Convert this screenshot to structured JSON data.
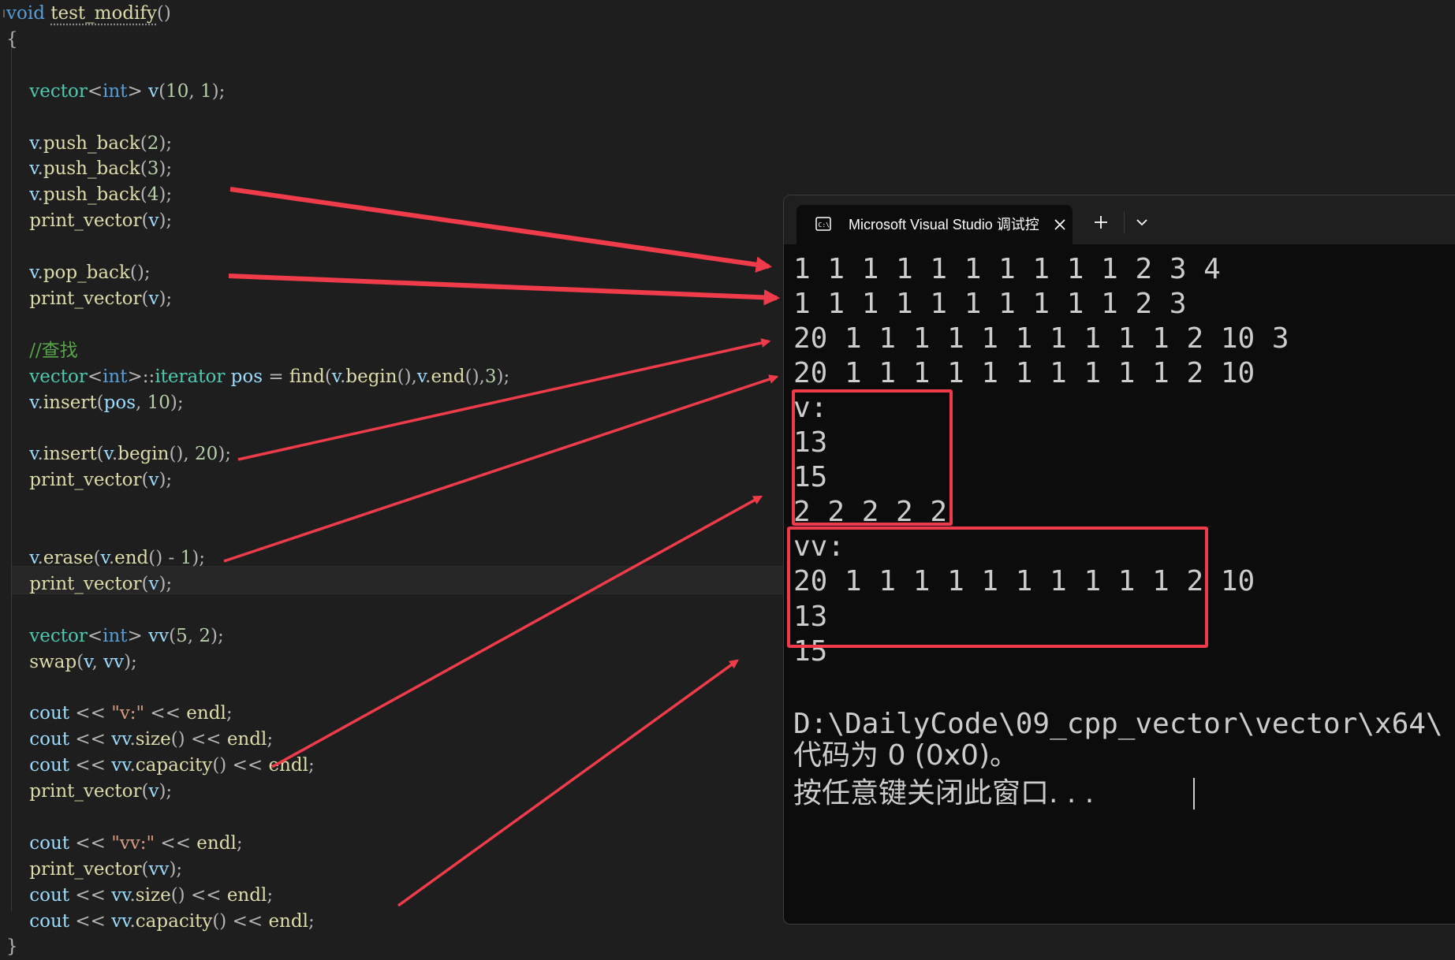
{
  "editor": {
    "lines": [
      [
        [
          "kw",
          "void"
        ],
        [
          "pl",
          " "
        ],
        [
          "fn",
          "test_modify",
          "underline"
        ],
        [
          "op",
          "()"
        ]
      ],
      [
        [
          "op",
          "{"
        ]
      ],
      [],
      [
        [
          "pl",
          "    "
        ],
        [
          "ty",
          "vector"
        ],
        [
          "op",
          "<"
        ],
        [
          "kw",
          "int"
        ],
        [
          "op",
          "> "
        ],
        [
          "va",
          "v"
        ],
        [
          "op",
          "("
        ],
        [
          "nu",
          "10"
        ],
        [
          "op",
          ", "
        ],
        [
          "nu",
          "1"
        ],
        [
          "op",
          ");"
        ]
      ],
      [],
      [
        [
          "pl",
          "    "
        ],
        [
          "va",
          "v"
        ],
        [
          "op",
          "."
        ],
        [
          "fn",
          "push_back"
        ],
        [
          "op",
          "("
        ],
        [
          "nu",
          "2"
        ],
        [
          "op",
          ");"
        ]
      ],
      [
        [
          "pl",
          "    "
        ],
        [
          "va",
          "v"
        ],
        [
          "op",
          "."
        ],
        [
          "fn",
          "push_back"
        ],
        [
          "op",
          "("
        ],
        [
          "nu",
          "3"
        ],
        [
          "op",
          ");"
        ]
      ],
      [
        [
          "pl",
          "    "
        ],
        [
          "va",
          "v"
        ],
        [
          "op",
          "."
        ],
        [
          "fn",
          "push_back"
        ],
        [
          "op",
          "("
        ],
        [
          "nu",
          "4"
        ],
        [
          "op",
          ");"
        ]
      ],
      [
        [
          "pl",
          "    "
        ],
        [
          "fn",
          "print_vector"
        ],
        [
          "op",
          "("
        ],
        [
          "va",
          "v"
        ],
        [
          "op",
          ");"
        ]
      ],
      [],
      [
        [
          "pl",
          "    "
        ],
        [
          "va",
          "v"
        ],
        [
          "op",
          "."
        ],
        [
          "fn",
          "pop_back"
        ],
        [
          "op",
          "();"
        ]
      ],
      [
        [
          "pl",
          "    "
        ],
        [
          "fn",
          "print_vector"
        ],
        [
          "op",
          "("
        ],
        [
          "va",
          "v"
        ],
        [
          "op",
          ");"
        ]
      ],
      [],
      [
        [
          "pl",
          "    "
        ],
        [
          "cm",
          "//查找"
        ]
      ],
      [
        [
          "pl",
          "    "
        ],
        [
          "ty",
          "vector"
        ],
        [
          "op",
          "<"
        ],
        [
          "kw",
          "int"
        ],
        [
          "op",
          ">::"
        ],
        [
          "ty",
          "iterator"
        ],
        [
          "pl",
          " "
        ],
        [
          "va",
          "pos"
        ],
        [
          "op",
          " = "
        ],
        [
          "fn",
          "find"
        ],
        [
          "op",
          "("
        ],
        [
          "va",
          "v"
        ],
        [
          "op",
          "."
        ],
        [
          "fn",
          "begin"
        ],
        [
          "op",
          "(),"
        ],
        [
          "va",
          "v"
        ],
        [
          "op",
          "."
        ],
        [
          "fn",
          "end"
        ],
        [
          "op",
          "(),"
        ],
        [
          "nu",
          "3"
        ],
        [
          "op",
          ");"
        ]
      ],
      [
        [
          "pl",
          "    "
        ],
        [
          "va",
          "v"
        ],
        [
          "op",
          "."
        ],
        [
          "fn",
          "insert"
        ],
        [
          "op",
          "("
        ],
        [
          "va",
          "pos"
        ],
        [
          "op",
          ", "
        ],
        [
          "nu",
          "10"
        ],
        [
          "op",
          ");"
        ]
      ],
      [],
      [
        [
          "pl",
          "    "
        ],
        [
          "va",
          "v"
        ],
        [
          "op",
          "."
        ],
        [
          "fn",
          "insert"
        ],
        [
          "op",
          "("
        ],
        [
          "va",
          "v"
        ],
        [
          "op",
          "."
        ],
        [
          "fn",
          "begin"
        ],
        [
          "op",
          "(), "
        ],
        [
          "nu",
          "20"
        ],
        [
          "op",
          ");"
        ]
      ],
      [
        [
          "pl",
          "    "
        ],
        [
          "fn",
          "print_vector"
        ],
        [
          "op",
          "("
        ],
        [
          "va",
          "v"
        ],
        [
          "op",
          ");"
        ]
      ],
      [],
      [],
      [
        [
          "pl",
          "    "
        ],
        [
          "va",
          "v"
        ],
        [
          "op",
          "."
        ],
        [
          "fn",
          "erase"
        ],
        [
          "op",
          "("
        ],
        [
          "va",
          "v"
        ],
        [
          "op",
          "."
        ],
        [
          "fn",
          "end"
        ],
        [
          "op",
          "() - "
        ],
        [
          "nu",
          "1"
        ],
        [
          "op",
          ");"
        ]
      ],
      [
        [
          "pl",
          "    "
        ],
        [
          "fn",
          "print_vector"
        ],
        [
          "op",
          "("
        ],
        [
          "va",
          "v"
        ],
        [
          "op",
          ");"
        ]
      ],
      [],
      [
        [
          "pl",
          "    "
        ],
        [
          "ty",
          "vector"
        ],
        [
          "op",
          "<"
        ],
        [
          "kw",
          "int"
        ],
        [
          "op",
          "> "
        ],
        [
          "va",
          "vv"
        ],
        [
          "op",
          "("
        ],
        [
          "nu",
          "5"
        ],
        [
          "op",
          ", "
        ],
        [
          "nu",
          "2"
        ],
        [
          "op",
          ");"
        ]
      ],
      [
        [
          "pl",
          "    "
        ],
        [
          "fn",
          "swap"
        ],
        [
          "op",
          "("
        ],
        [
          "va",
          "v"
        ],
        [
          "op",
          ", "
        ],
        [
          "va",
          "vv"
        ],
        [
          "op",
          ");"
        ]
      ],
      [],
      [
        [
          "pl",
          "    "
        ],
        [
          "va",
          "cout"
        ],
        [
          "op",
          " << "
        ],
        [
          "st",
          "\"v:\""
        ],
        [
          "op",
          " << "
        ],
        [
          "fn",
          "endl"
        ],
        [
          "op",
          ";"
        ]
      ],
      [
        [
          "pl",
          "    "
        ],
        [
          "va",
          "cout"
        ],
        [
          "op",
          " << "
        ],
        [
          "va",
          "vv"
        ],
        [
          "op",
          "."
        ],
        [
          "fn",
          "size"
        ],
        [
          "op",
          "() << "
        ],
        [
          "fn",
          "endl"
        ],
        [
          "op",
          ";"
        ]
      ],
      [
        [
          "pl",
          "    "
        ],
        [
          "va",
          "cout"
        ],
        [
          "op",
          " << "
        ],
        [
          "va",
          "vv"
        ],
        [
          "op",
          "."
        ],
        [
          "fn",
          "capacity"
        ],
        [
          "op",
          "() << "
        ],
        [
          "fn",
          "endl"
        ],
        [
          "op",
          ";"
        ]
      ],
      [
        [
          "pl",
          "    "
        ],
        [
          "fn",
          "print_vector"
        ],
        [
          "op",
          "("
        ],
        [
          "va",
          "v"
        ],
        [
          "op",
          ");"
        ]
      ],
      [],
      [
        [
          "pl",
          "    "
        ],
        [
          "va",
          "cout"
        ],
        [
          "op",
          " << "
        ],
        [
          "st",
          "\"vv:\""
        ],
        [
          "op",
          " << "
        ],
        [
          "fn",
          "endl"
        ],
        [
          "op",
          ";"
        ]
      ],
      [
        [
          "pl",
          "    "
        ],
        [
          "fn",
          "print_vector"
        ],
        [
          "op",
          "("
        ],
        [
          "va",
          "vv"
        ],
        [
          "op",
          ");"
        ]
      ],
      [
        [
          "pl",
          "    "
        ],
        [
          "va",
          "cout"
        ],
        [
          "op",
          " << "
        ],
        [
          "va",
          "vv"
        ],
        [
          "op",
          "."
        ],
        [
          "fn",
          "size"
        ],
        [
          "op",
          "() << "
        ],
        [
          "fn",
          "endl"
        ],
        [
          "op",
          ";"
        ]
      ],
      [
        [
          "pl",
          "    "
        ],
        [
          "va",
          "cout"
        ],
        [
          "op",
          " << "
        ],
        [
          "va",
          "vv"
        ],
        [
          "op",
          "."
        ],
        [
          "fn",
          "capacity"
        ],
        [
          "op",
          "() << "
        ],
        [
          "fn",
          "endl"
        ],
        [
          "op",
          ";"
        ]
      ],
      [
        [
          "op",
          "}"
        ]
      ]
    ]
  },
  "console": {
    "tab_title": "Microsoft Visual Studio 调试控",
    "icons": {
      "tab": "terminal-icon",
      "close": "close-icon",
      "new": "plus-icon",
      "menu": "chevron-down-icon"
    },
    "output": [
      "1 1 1 1 1 1 1 1 1 1 2 3 4",
      "1 1 1 1 1 1 1 1 1 1 2 3",
      "20 1 1 1 1 1 1 1 1 1 1 2 10 3",
      "20 1 1 1 1 1 1 1 1 1 1 2 10",
      "v:",
      "13",
      "15",
      "2 2 2 2 2",
      "vv:",
      "20 1 1 1 1 1 1 1 1 1 1 2 10",
      "13",
      "15",
      "",
      "D:\\DailyCode\\09_cpp_vector\\vector\\x64\\",
      "代码为 0 (0x0)。",
      "按任意键关闭此窗口. . ."
    ]
  },
  "annotation_color": "#ef3b4a"
}
